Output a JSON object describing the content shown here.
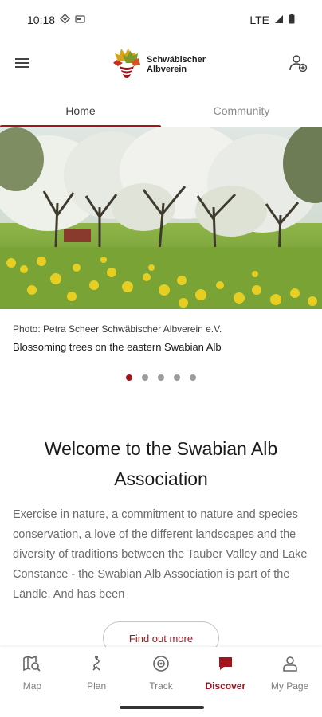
{
  "status_bar": {
    "time": "10:18",
    "network": "LTE"
  },
  "header": {
    "logo_text": "Schwäbischer Albverein",
    "icons": [
      "menu-icon",
      "add-person-icon"
    ]
  },
  "tabs": [
    {
      "label": "Home",
      "active": true
    },
    {
      "label": "Community",
      "active": false
    }
  ],
  "carousel": {
    "photo_credit": "Photo: Petra Scheer Schwäbischer Albverein e.V.",
    "caption": "Blossoming trees on the eastern Swabian Alb",
    "dot_count": 5,
    "active_index": 0
  },
  "main": {
    "welcome_title": "Welcome to the Swabian Alb Association",
    "intro_text": "Exercise in nature, a commitment to nature and species conservation, a love of the different landscapes and the diversity of traditions between the Tauber Valley and Lake Constance - the Swabian Alb Association is part of the Ländle. And has been",
    "cta_label": "Find out more"
  },
  "bottom_nav": [
    {
      "label": "Map",
      "icon": "map-search-icon",
      "active": false
    },
    {
      "label": "Plan",
      "icon": "route-icon",
      "active": false
    },
    {
      "label": "Track",
      "icon": "target-icon",
      "active": false
    },
    {
      "label": "Discover",
      "icon": "chat-bubble-icon",
      "active": true
    },
    {
      "label": "My Page",
      "icon": "person-icon",
      "active": false
    }
  ],
  "colors": {
    "accent": "#a3141d",
    "muted_text": "#6b6b6b"
  }
}
